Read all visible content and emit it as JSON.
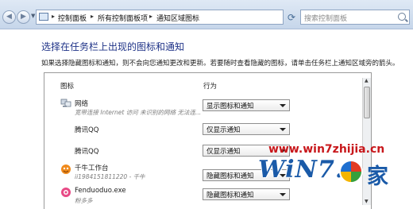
{
  "address_bar": {
    "breadcrumbs": [
      "控制面板",
      "所有控制面板项",
      "通知区域图标"
    ],
    "separator": "▸",
    "search_placeholder": "搜索控制面板"
  },
  "heading": {
    "title": "选择在任务栏上出现的图标和通知",
    "description": "如果选择隐藏图标和通知，则不会向您通知更改和更新。若要随时查看隐藏的图标，请单击任务栏上通知区域旁的箭头。"
  },
  "table": {
    "columns": {
      "icon": "图标",
      "behavior": "行为"
    },
    "rows": [
      {
        "name": "网络",
        "subtitle": "宽带连接 Internet 访问 未识别的网络 无法连...",
        "behavior": "显示图标和通知",
        "icon": "network-icon"
      },
      {
        "name": "腾讯QQ",
        "subtitle": "",
        "behavior": "仅显示通知",
        "icon": ""
      },
      {
        "name": "腾讯QQ",
        "subtitle": "",
        "behavior": "仅显示通知",
        "icon": ""
      },
      {
        "name": "千牛工作台",
        "subtitle": "ii1984151811220 - 千牛",
        "behavior": "隐藏图标和通知",
        "icon": "qianniu-icon"
      },
      {
        "name": "Fenduoduo.exe",
        "subtitle": "粉多多",
        "behavior": "隐藏图标和通知",
        "icon": "fenduoduo-icon"
      }
    ]
  },
  "watermark": {
    "url": "www.win7zhijia.cn",
    "logo": "WiN7.",
    "logo_char": "家"
  },
  "colors": {
    "title": "#1e3287",
    "watermark_url": "#c8171b",
    "watermark_logo": "#1a5aa8"
  }
}
